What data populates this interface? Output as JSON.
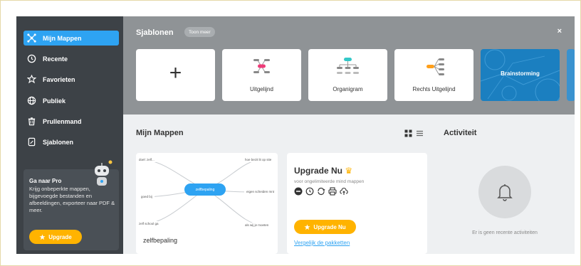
{
  "sidebar": {
    "items": [
      {
        "label": "Mijn Mappen",
        "icon": "mindmap-icon",
        "active": true
      },
      {
        "label": "Recente",
        "icon": "clock-icon",
        "active": false
      },
      {
        "label": "Favorieten",
        "icon": "star-icon",
        "active": false
      },
      {
        "label": "Publiek",
        "icon": "globe-icon",
        "active": false
      },
      {
        "label": "Prullenmand",
        "icon": "trash-icon",
        "active": false
      },
      {
        "label": "Sjablonen",
        "icon": "template-icon",
        "active": false
      }
    ],
    "pro": {
      "title": "Ga naar Pro",
      "text": "Krijg onbeperkte mappen, bijgevoegde bestanden en afbeeldingen, exporteer naar PDF & meer.",
      "button": "Upgrade"
    }
  },
  "templates": {
    "title": "Sjablonen",
    "more": "Toon meer",
    "close": "×",
    "cards": [
      {
        "label": "",
        "kind": "new"
      },
      {
        "label": "Uitgelijnd",
        "kind": "centered"
      },
      {
        "label": "Organigram",
        "kind": "org"
      },
      {
        "label": "Rechts Uitgelijnd",
        "kind": "right"
      },
      {
        "label": "Brainstorming",
        "kind": "image"
      }
    ]
  },
  "maps": {
    "title": "Mijn Mappen",
    "map_card": {
      "name": "zelfbepaling",
      "center": "zelfbepaling",
      "nodes": [
        "doel: zelf...",
        "hoe bezit lit op site",
        "zelfbepalings",
        "eigen scheiden mnt",
        "goed bij",
        "zelf school ga",
        "als wij je moeten"
      ]
    },
    "upgrade": {
      "title": "Upgrade Nu",
      "subtitle": "voor ongelimiteerde mind mappen",
      "button": "Upgrade Nu",
      "link": "Vergelijk de pakketten"
    }
  },
  "activity": {
    "title": "Activiteit",
    "empty": "Er is geen recente activiteiten"
  },
  "colors": {
    "accent": "#2ea3f2",
    "sidebar": "#3d4247",
    "upgrade": "#ffb300",
    "templates_band": "#8f9396"
  }
}
